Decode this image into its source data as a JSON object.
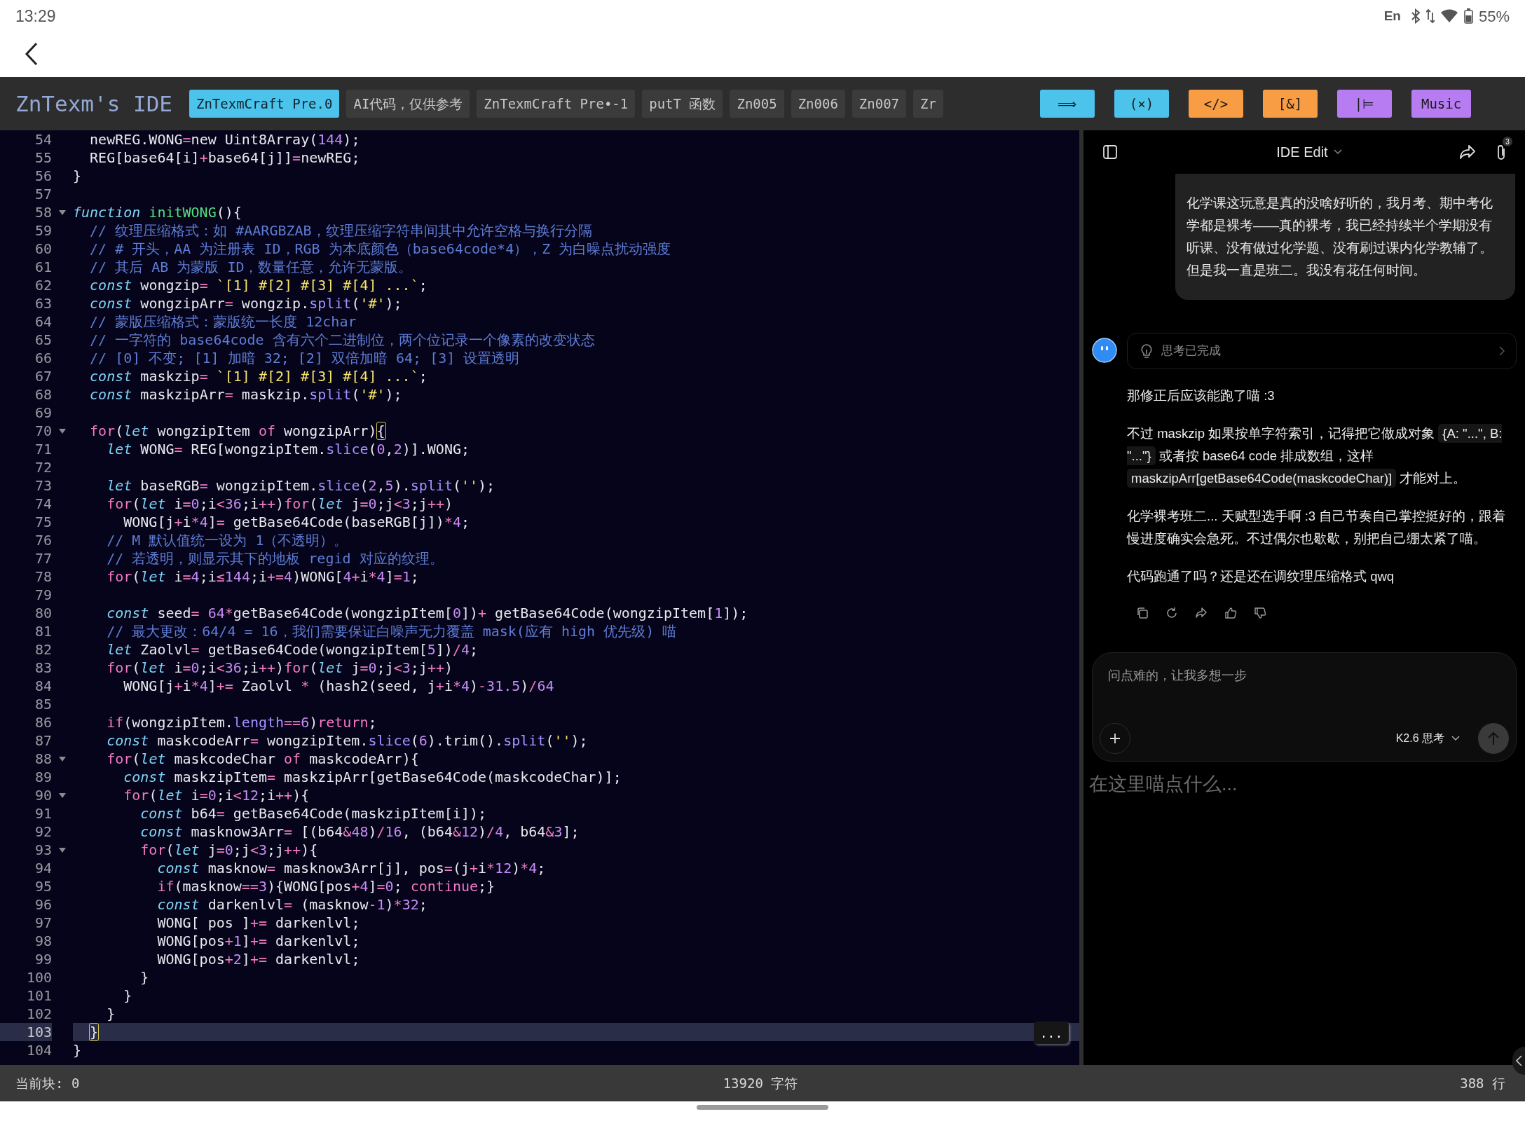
{
  "phone_status": {
    "time": "13:29",
    "input_language": "En",
    "battery": "55%"
  },
  "ide": {
    "title": "ZnTexm's IDE",
    "tabs": [
      {
        "label": "ZnTexmCraft Pre.0",
        "selected": true
      },
      {
        "label": "AI代码，仅供参考",
        "selected": false
      },
      {
        "label": "ZnTexmCraft Pre•-1",
        "selected": false
      },
      {
        "label": "putT 函数",
        "selected": false
      },
      {
        "label": "Zn005",
        "selected": false
      },
      {
        "label": "Zn006",
        "selected": false
      },
      {
        "label": "Zn007",
        "selected": false
      },
      {
        "label": "Zr",
        "selected": false
      }
    ],
    "tools": [
      {
        "label": "⟹",
        "color": "#4cc3ea"
      },
      {
        "label": "(×)",
        "color": "#4cc3ea"
      },
      {
        "label": "</>",
        "color": "#f99d45"
      },
      {
        "label": "[&]",
        "color": "#f99d45"
      },
      {
        "label": "|⊨",
        "color": "#b77cf2"
      },
      {
        "label": "Music",
        "color": "#b77cf2"
      }
    ]
  },
  "editor": {
    "more_button": "...",
    "lines": [
      {
        "number": "54",
        "fold": false,
        "current": false,
        "tokens": [
          {
            "kind": "plain",
            "text": "  newREG.WONG"
          },
          {
            "kind": "op",
            "text": "="
          },
          {
            "kind": "plain",
            "text": "new Uint8Array("
          },
          {
            "kind": "num",
            "text": "144"
          },
          {
            "kind": "plain",
            "text": ");"
          }
        ]
      },
      {
        "number": "55",
        "fold": false,
        "current": false,
        "tokens": [
          {
            "kind": "plain",
            "text": "  REG[base64[i]"
          },
          {
            "kind": "op",
            "text": "+"
          },
          {
            "kind": "plain",
            "text": "base64[j]]"
          },
          {
            "kind": "op",
            "text": "="
          },
          {
            "kind": "plain",
            "text": "newREG;"
          }
        ]
      },
      {
        "number": "56",
        "fold": false,
        "current": false,
        "tokens": [
          {
            "kind": "plain",
            "text": "}"
          }
        ]
      },
      {
        "number": "57",
        "fold": false,
        "current": false
      },
      {
        "number": "58",
        "fold": true,
        "current": false,
        "tokens": [
          {
            "kind": "kw",
            "text": "function"
          },
          {
            "kind": "fn",
            "text": " initWONG"
          },
          {
            "kind": "plain",
            "text": "(){"
          }
        ]
      },
      {
        "number": "59",
        "fold": false,
        "current": false,
        "tokens": [
          {
            "kind": "com",
            "text": "  // 纹理压缩格式：如 #AARGBZAB，纹理压缩字符串间其中允许空格与换行分隔"
          }
        ]
      },
      {
        "number": "60",
        "fold": false,
        "current": false,
        "tokens": [
          {
            "kind": "com",
            "text": "  // # 开头，AA 为注册表 ID，RGB 为本底颜色（base64code*4），Z 为白噪点扰动强度"
          }
        ]
      },
      {
        "number": "61",
        "fold": false,
        "current": false,
        "tokens": [
          {
            "kind": "com",
            "text": "  // 其后 AB 为蒙版 ID，数量任意，允许无蒙版。"
          }
        ]
      },
      {
        "number": "62",
        "fold": false,
        "current": false,
        "tokens": [
          {
            "kind": "kw",
            "text": "  const"
          },
          {
            "kind": "plain",
            "text": " wongzip"
          },
          {
            "kind": "op",
            "text": "="
          },
          {
            "kind": "str",
            "text": " `[1] #[2] #[3] #[4] ...`"
          },
          {
            "kind": "plain",
            "text": ";"
          }
        ]
      },
      {
        "number": "63",
        "fold": false,
        "current": false,
        "tokens": [
          {
            "kind": "kw",
            "text": "  const"
          },
          {
            "kind": "plain",
            "text": " wongzipArr"
          },
          {
            "kind": "op",
            "text": "="
          },
          {
            "kind": "plain",
            "text": " wongzip."
          },
          {
            "kind": "method",
            "text": "split"
          },
          {
            "kind": "plain",
            "text": "("
          },
          {
            "kind": "str",
            "text": "'#'"
          },
          {
            "kind": "plain",
            "text": ");"
          }
        ]
      },
      {
        "number": "64",
        "fold": false,
        "current": false,
        "tokens": [
          {
            "kind": "com",
            "text": "  // 蒙版压缩格式：蒙版统一长度 12char"
          }
        ]
      },
      {
        "number": "65",
        "fold": false,
        "current": false,
        "tokens": [
          {
            "kind": "com",
            "text": "  // 一字符的 base64code 含有六个二进制位，两个位记录一个像素的改变状态"
          }
        ]
      },
      {
        "number": "66",
        "fold": false,
        "current": false,
        "tokens": [
          {
            "kind": "com",
            "text": "  // [0] 不变; [1] 加暗 32; [2] 双倍加暗 64; [3] 设置透明"
          }
        ]
      },
      {
        "number": "67",
        "fold": false,
        "current": false,
        "tokens": [
          {
            "kind": "kw",
            "text": "  const"
          },
          {
            "kind": "plain",
            "text": " maskzip"
          },
          {
            "kind": "op",
            "text": "="
          },
          {
            "kind": "str",
            "text": " `[1] #[2] #[3] #[4] ...`"
          },
          {
            "kind": "plain",
            "text": ";"
          }
        ]
      },
      {
        "number": "68",
        "fold": false,
        "current": false,
        "tokens": [
          {
            "kind": "kw",
            "text": "  const"
          },
          {
            "kind": "plain",
            "text": " maskzipArr"
          },
          {
            "kind": "op",
            "text": "="
          },
          {
            "kind": "plain",
            "text": " maskzip."
          },
          {
            "kind": "method",
            "text": "split"
          },
          {
            "kind": "plain",
            "text": "("
          },
          {
            "kind": "str",
            "text": "'#'"
          },
          {
            "kind": "plain",
            "text": ");"
          }
        ]
      },
      {
        "number": "69",
        "fold": false,
        "current": false
      },
      {
        "number": "70",
        "fold": true,
        "current": false,
        "tokens": [
          {
            "kind": "ctl",
            "text": "  for"
          },
          {
            "kind": "plain",
            "text": "("
          },
          {
            "kind": "kw",
            "text": "let"
          },
          {
            "kind": "plain",
            "text": " wongzipItem "
          },
          {
            "kind": "ctl",
            "text": "of"
          },
          {
            "kind": "plain",
            "text": " wongzipArr)"
          },
          {
            "kind": "match",
            "text": "{"
          }
        ]
      },
      {
        "number": "71",
        "fold": false,
        "current": false,
        "tokens": [
          {
            "kind": "kw",
            "text": "    let"
          },
          {
            "kind": "plain",
            "text": " WONG"
          },
          {
            "kind": "op",
            "text": "="
          },
          {
            "kind": "plain",
            "text": " REG[wongzipItem."
          },
          {
            "kind": "method",
            "text": "slice"
          },
          {
            "kind": "plain",
            "text": "("
          },
          {
            "kind": "num",
            "text": "0"
          },
          {
            "kind": "plain",
            "text": ","
          },
          {
            "kind": "num",
            "text": "2"
          },
          {
            "kind": "plain",
            "text": ")].WONG;"
          }
        ]
      },
      {
        "number": "72",
        "fold": false,
        "current": false
      },
      {
        "number": "73",
        "fold": false,
        "current": false,
        "tokens": [
          {
            "kind": "kw",
            "text": "    let"
          },
          {
            "kind": "plain",
            "text": " baseRGB"
          },
          {
            "kind": "op",
            "text": "="
          },
          {
            "kind": "plain",
            "text": " wongzipItem."
          },
          {
            "kind": "method",
            "text": "slice"
          },
          {
            "kind": "plain",
            "text": "("
          },
          {
            "kind": "num",
            "text": "2"
          },
          {
            "kind": "plain",
            "text": ","
          },
          {
            "kind": "num",
            "text": "5"
          },
          {
            "kind": "plain",
            "text": ")."
          },
          {
            "kind": "method",
            "text": "split"
          },
          {
            "kind": "plain",
            "text": "("
          },
          {
            "kind": "str",
            "text": "''"
          },
          {
            "kind": "plain",
            "text": ");"
          }
        ]
      },
      {
        "number": "74",
        "fold": false,
        "current": false,
        "tokens": [
          {
            "kind": "ctl",
            "text": "    for"
          },
          {
            "kind": "plain",
            "text": "("
          },
          {
            "kind": "kw",
            "text": "let"
          },
          {
            "kind": "plain",
            "text": " i"
          },
          {
            "kind": "op",
            "text": "="
          },
          {
            "kind": "num",
            "text": "0"
          },
          {
            "kind": "plain",
            "text": ";i"
          },
          {
            "kind": "op",
            "text": "<"
          },
          {
            "kind": "num",
            "text": "36"
          },
          {
            "kind": "plain",
            "text": ";i"
          },
          {
            "kind": "op",
            "text": "++"
          },
          {
            "kind": "plain",
            "text": ")"
          },
          {
            "kind": "ctl",
            "text": "for"
          },
          {
            "kind": "plain",
            "text": "("
          },
          {
            "kind": "kw",
            "text": "let"
          },
          {
            "kind": "plain",
            "text": " j"
          },
          {
            "kind": "op",
            "text": "="
          },
          {
            "kind": "num",
            "text": "0"
          },
          {
            "kind": "plain",
            "text": ";j"
          },
          {
            "kind": "op",
            "text": "<"
          },
          {
            "kind": "num",
            "text": "3"
          },
          {
            "kind": "plain",
            "text": ";j"
          },
          {
            "kind": "op",
            "text": "++"
          },
          {
            "kind": "plain",
            "text": ")"
          }
        ]
      },
      {
        "number": "75",
        "fold": false,
        "current": false,
        "tokens": [
          {
            "kind": "plain",
            "text": "      WONG[j"
          },
          {
            "kind": "op",
            "text": "+"
          },
          {
            "kind": "plain",
            "text": "i"
          },
          {
            "kind": "op",
            "text": "*"
          },
          {
            "kind": "num",
            "text": "4"
          },
          {
            "kind": "plain",
            "text": "]"
          },
          {
            "kind": "op",
            "text": "="
          },
          {
            "kind": "plain",
            "text": " getBase64Code(baseRGB[j])"
          },
          {
            "kind": "op",
            "text": "*"
          },
          {
            "kind": "num",
            "text": "4"
          },
          {
            "kind": "plain",
            "text": ";"
          }
        ]
      },
      {
        "number": "76",
        "fold": false,
        "current": false,
        "tokens": [
          {
            "kind": "com",
            "text": "    // M 默认值统一设为 1（不透明）。"
          }
        ]
      },
      {
        "number": "77",
        "fold": false,
        "current": false,
        "tokens": [
          {
            "kind": "com",
            "text": "    // 若透明，则显示其下的地板 regid 对应的纹理。"
          }
        ]
      },
      {
        "number": "78",
        "fold": false,
        "current": false,
        "tokens": [
          {
            "kind": "ctl",
            "text": "    for"
          },
          {
            "kind": "plain",
            "text": "("
          },
          {
            "kind": "kw",
            "text": "let"
          },
          {
            "kind": "plain",
            "text": " i"
          },
          {
            "kind": "op",
            "text": "="
          },
          {
            "kind": "num",
            "text": "4"
          },
          {
            "kind": "plain",
            "text": ";i"
          },
          {
            "kind": "op",
            "text": "≤"
          },
          {
            "kind": "num",
            "text": "144"
          },
          {
            "kind": "plain",
            "text": ";i"
          },
          {
            "kind": "op",
            "text": "+="
          },
          {
            "kind": "num",
            "text": "4"
          },
          {
            "kind": "plain",
            "text": ")WONG["
          },
          {
            "kind": "num",
            "text": "4"
          },
          {
            "kind": "op",
            "text": "+"
          },
          {
            "kind": "plain",
            "text": "i"
          },
          {
            "kind": "op",
            "text": "*"
          },
          {
            "kind": "num",
            "text": "4"
          },
          {
            "kind": "plain",
            "text": "]"
          },
          {
            "kind": "op",
            "text": "="
          },
          {
            "kind": "num",
            "text": "1"
          },
          {
            "kind": "plain",
            "text": ";"
          }
        ]
      },
      {
        "number": "79",
        "fold": false,
        "current": false
      },
      {
        "number": "80",
        "fold": false,
        "current": false,
        "tokens": [
          {
            "kind": "kw",
            "text": "    const"
          },
          {
            "kind": "plain",
            "text": " seed"
          },
          {
            "kind": "op",
            "text": "="
          },
          {
            "kind": "num",
            "text": " 64"
          },
          {
            "kind": "op",
            "text": "*"
          },
          {
            "kind": "plain",
            "text": "getBase64Code(wongzipItem["
          },
          {
            "kind": "num",
            "text": "0"
          },
          {
            "kind": "plain",
            "text": "])"
          },
          {
            "kind": "op",
            "text": "+"
          },
          {
            "kind": "plain",
            "text": " getBase64Code(wongzipItem["
          },
          {
            "kind": "num",
            "text": "1"
          },
          {
            "kind": "plain",
            "text": "]);"
          }
        ]
      },
      {
        "number": "81",
        "fold": false,
        "current": false,
        "tokens": [
          {
            "kind": "com",
            "text": "    // 最大更改：64/4 = 16，我们需要保证白噪声无力覆盖 mask(应有 high 优先级) 喵"
          }
        ]
      },
      {
        "number": "82",
        "fold": false,
        "current": false,
        "tokens": [
          {
            "kind": "kw",
            "text": "    let"
          },
          {
            "kind": "plain",
            "text": " Zaolvl"
          },
          {
            "kind": "op",
            "text": "="
          },
          {
            "kind": "plain",
            "text": " getBase64Code(wongzipItem["
          },
          {
            "kind": "num",
            "text": "5"
          },
          {
            "kind": "plain",
            "text": "])"
          },
          {
            "kind": "op",
            "text": "/"
          },
          {
            "kind": "num",
            "text": "4"
          },
          {
            "kind": "plain",
            "text": ";"
          }
        ]
      },
      {
        "number": "83",
        "fold": false,
        "current": false,
        "tokens": [
          {
            "kind": "ctl",
            "text": "    for"
          },
          {
            "kind": "plain",
            "text": "("
          },
          {
            "kind": "kw",
            "text": "let"
          },
          {
            "kind": "plain",
            "text": " i"
          },
          {
            "kind": "op",
            "text": "="
          },
          {
            "kind": "num",
            "text": "0"
          },
          {
            "kind": "plain",
            "text": ";i"
          },
          {
            "kind": "op",
            "text": "<"
          },
          {
            "kind": "num",
            "text": "36"
          },
          {
            "kind": "plain",
            "text": ";i"
          },
          {
            "kind": "op",
            "text": "++"
          },
          {
            "kind": "plain",
            "text": ")"
          },
          {
            "kind": "ctl",
            "text": "for"
          },
          {
            "kind": "plain",
            "text": "("
          },
          {
            "kind": "kw",
            "text": "let"
          },
          {
            "kind": "plain",
            "text": " j"
          },
          {
            "kind": "op",
            "text": "="
          },
          {
            "kind": "num",
            "text": "0"
          },
          {
            "kind": "plain",
            "text": ";j"
          },
          {
            "kind": "op",
            "text": "<"
          },
          {
            "kind": "num",
            "text": "3"
          },
          {
            "kind": "plain",
            "text": ";j"
          },
          {
            "kind": "op",
            "text": "++"
          },
          {
            "kind": "plain",
            "text": ")"
          }
        ]
      },
      {
        "number": "84",
        "fold": false,
        "current": false,
        "tokens": [
          {
            "kind": "plain",
            "text": "      WONG[j"
          },
          {
            "kind": "op",
            "text": "+"
          },
          {
            "kind": "plain",
            "text": "i"
          },
          {
            "kind": "op",
            "text": "*"
          },
          {
            "kind": "num",
            "text": "4"
          },
          {
            "kind": "plain",
            "text": "]"
          },
          {
            "kind": "op",
            "text": "+="
          },
          {
            "kind": "plain",
            "text": " Zaolvl "
          },
          {
            "kind": "op",
            "text": "*"
          },
          {
            "kind": "plain",
            "text": " (hash2(seed, j"
          },
          {
            "kind": "op",
            "text": "+"
          },
          {
            "kind": "plain",
            "text": "i"
          },
          {
            "kind": "op",
            "text": "*"
          },
          {
            "kind": "num",
            "text": "4"
          },
          {
            "kind": "plain",
            "text": ")"
          },
          {
            "kind": "op",
            "text": "-"
          },
          {
            "kind": "num",
            "text": "31.5"
          },
          {
            "kind": "plain",
            "text": ")"
          },
          {
            "kind": "op",
            "text": "/"
          },
          {
            "kind": "num",
            "text": "64"
          }
        ]
      },
      {
        "number": "85",
        "fold": false,
        "current": false
      },
      {
        "number": "86",
        "fold": false,
        "current": false,
        "tokens": [
          {
            "kind": "ctl",
            "text": "    if"
          },
          {
            "kind": "plain",
            "text": "(wongzipItem."
          },
          {
            "kind": "method",
            "text": "length"
          },
          {
            "kind": "op",
            "text": "=="
          },
          {
            "kind": "num",
            "text": "6"
          },
          {
            "kind": "plain",
            "text": ")"
          },
          {
            "kind": "ctl",
            "text": "return"
          },
          {
            "kind": "plain",
            "text": ";"
          }
        ]
      },
      {
        "number": "87",
        "fold": false,
        "current": false,
        "tokens": [
          {
            "kind": "kw",
            "text": "    const"
          },
          {
            "kind": "plain",
            "text": " maskcodeArr"
          },
          {
            "kind": "op",
            "text": "="
          },
          {
            "kind": "plain",
            "text": " wongzipItem."
          },
          {
            "kind": "method",
            "text": "slice"
          },
          {
            "kind": "plain",
            "text": "("
          },
          {
            "kind": "num",
            "text": "6"
          },
          {
            "kind": "plain",
            "text": ").trim()."
          },
          {
            "kind": "method",
            "text": "split"
          },
          {
            "kind": "plain",
            "text": "("
          },
          {
            "kind": "str",
            "text": "''"
          },
          {
            "kind": "plain",
            "text": ");"
          }
        ]
      },
      {
        "number": "88",
        "fold": true,
        "current": false,
        "tokens": [
          {
            "kind": "ctl",
            "text": "    for"
          },
          {
            "kind": "plain",
            "text": "("
          },
          {
            "kind": "kw",
            "text": "let"
          },
          {
            "kind": "plain",
            "text": " maskcodeChar "
          },
          {
            "kind": "ctl",
            "text": "of"
          },
          {
            "kind": "plain",
            "text": " maskcodeArr){"
          }
        ]
      },
      {
        "number": "89",
        "fold": false,
        "current": false,
        "tokens": [
          {
            "kind": "kw",
            "text": "      const"
          },
          {
            "kind": "plain",
            "text": " maskzipItem"
          },
          {
            "kind": "op",
            "text": "="
          },
          {
            "kind": "plain",
            "text": " maskzipArr[getBase64Code(maskcodeChar)];"
          }
        ]
      },
      {
        "number": "90",
        "fold": true,
        "current": false,
        "tokens": [
          {
            "kind": "ctl",
            "text": "      for"
          },
          {
            "kind": "plain",
            "text": "("
          },
          {
            "kind": "kw",
            "text": "let"
          },
          {
            "kind": "plain",
            "text": " i"
          },
          {
            "kind": "op",
            "text": "="
          },
          {
            "kind": "num",
            "text": "0"
          },
          {
            "kind": "plain",
            "text": ";i"
          },
          {
            "kind": "op",
            "text": "<"
          },
          {
            "kind": "num",
            "text": "12"
          },
          {
            "kind": "plain",
            "text": ";i"
          },
          {
            "kind": "op",
            "text": "++"
          },
          {
            "kind": "plain",
            "text": "){"
          }
        ]
      },
      {
        "number": "91",
        "fold": false,
        "current": false,
        "tokens": [
          {
            "kind": "kw",
            "text": "        const"
          },
          {
            "kind": "plain",
            "text": " b64"
          },
          {
            "kind": "op",
            "text": "="
          },
          {
            "kind": "plain",
            "text": " getBase64Code(maskzipItem[i]);"
          }
        ]
      },
      {
        "number": "92",
        "fold": false,
        "current": false,
        "tokens": [
          {
            "kind": "kw",
            "text": "        const"
          },
          {
            "kind": "plain",
            "text": " masknow3Arr"
          },
          {
            "kind": "op",
            "text": "="
          },
          {
            "kind": "plain",
            "text": " [(b64"
          },
          {
            "kind": "op",
            "text": "&"
          },
          {
            "kind": "num",
            "text": "48"
          },
          {
            "kind": "plain",
            "text": ")"
          },
          {
            "kind": "op",
            "text": "/"
          },
          {
            "kind": "num",
            "text": "16"
          },
          {
            "kind": "plain",
            "text": ", (b64"
          },
          {
            "kind": "op",
            "text": "&"
          },
          {
            "kind": "num",
            "text": "12"
          },
          {
            "kind": "plain",
            "text": ")"
          },
          {
            "kind": "op",
            "text": "/"
          },
          {
            "kind": "num",
            "text": "4"
          },
          {
            "kind": "plain",
            "text": ", b64"
          },
          {
            "kind": "op",
            "text": "&"
          },
          {
            "kind": "num",
            "text": "3"
          },
          {
            "kind": "plain",
            "text": "];"
          }
        ]
      },
      {
        "number": "93",
        "fold": true,
        "current": false,
        "tokens": [
          {
            "kind": "ctl",
            "text": "        for"
          },
          {
            "kind": "plain",
            "text": "("
          },
          {
            "kind": "kw",
            "text": "let"
          },
          {
            "kind": "plain",
            "text": " j"
          },
          {
            "kind": "op",
            "text": "="
          },
          {
            "kind": "num",
            "text": "0"
          },
          {
            "kind": "plain",
            "text": ";j"
          },
          {
            "kind": "op",
            "text": "<"
          },
          {
            "kind": "num",
            "text": "3"
          },
          {
            "kind": "plain",
            "text": ";j"
          },
          {
            "kind": "op",
            "text": "++"
          },
          {
            "kind": "plain",
            "text": "){"
          }
        ]
      },
      {
        "number": "94",
        "fold": false,
        "current": false,
        "tokens": [
          {
            "kind": "kw",
            "text": "          const"
          },
          {
            "kind": "plain",
            "text": " masknow"
          },
          {
            "kind": "op",
            "text": "="
          },
          {
            "kind": "plain",
            "text": " masknow3Arr[j], pos"
          },
          {
            "kind": "op",
            "text": "="
          },
          {
            "kind": "plain",
            "text": "(j"
          },
          {
            "kind": "op",
            "text": "+"
          },
          {
            "kind": "plain",
            "text": "i"
          },
          {
            "kind": "op",
            "text": "*"
          },
          {
            "kind": "num",
            "text": "12"
          },
          {
            "kind": "plain",
            "text": ")"
          },
          {
            "kind": "op",
            "text": "*"
          },
          {
            "kind": "num",
            "text": "4"
          },
          {
            "kind": "plain",
            "text": ";"
          }
        ]
      },
      {
        "number": "95",
        "fold": false,
        "current": false,
        "tokens": [
          {
            "kind": "ctl",
            "text": "          if"
          },
          {
            "kind": "plain",
            "text": "(masknow"
          },
          {
            "kind": "op",
            "text": "=="
          },
          {
            "kind": "num",
            "text": "3"
          },
          {
            "kind": "plain",
            "text": "){WONG[pos"
          },
          {
            "kind": "op",
            "text": "+"
          },
          {
            "kind": "num",
            "text": "4"
          },
          {
            "kind": "plain",
            "text": "]"
          },
          {
            "kind": "op",
            "text": "="
          },
          {
            "kind": "num",
            "text": "0"
          },
          {
            "kind": "plain",
            "text": ";"
          },
          {
            "kind": "ctl",
            "text": " continue"
          },
          {
            "kind": "plain",
            "text": ";}"
          }
        ]
      },
      {
        "number": "96",
        "fold": false,
        "current": false,
        "tokens": [
          {
            "kind": "kw",
            "text": "          const"
          },
          {
            "kind": "plain",
            "text": " darkenlvl"
          },
          {
            "kind": "op",
            "text": "="
          },
          {
            "kind": "plain",
            "text": " (masknow"
          },
          {
            "kind": "op",
            "text": "-"
          },
          {
            "kind": "num",
            "text": "1"
          },
          {
            "kind": "plain",
            "text": ")"
          },
          {
            "kind": "op",
            "text": "*"
          },
          {
            "kind": "num",
            "text": "32"
          },
          {
            "kind": "plain",
            "text": ";"
          }
        ]
      },
      {
        "number": "97",
        "fold": false,
        "current": false,
        "tokens": [
          {
            "kind": "plain",
            "text": "          WONG[ pos ]"
          },
          {
            "kind": "op",
            "text": "+="
          },
          {
            "kind": "plain",
            "text": " darkenlvl;"
          }
        ]
      },
      {
        "number": "98",
        "fold": false,
        "current": false,
        "tokens": [
          {
            "kind": "plain",
            "text": "          WONG[pos"
          },
          {
            "kind": "op",
            "text": "+"
          },
          {
            "kind": "num",
            "text": "1"
          },
          {
            "kind": "plain",
            "text": "]"
          },
          {
            "kind": "op",
            "text": "+="
          },
          {
            "kind": "plain",
            "text": " darkenlvl;"
          }
        ]
      },
      {
        "number": "99",
        "fold": false,
        "current": false,
        "tokens": [
          {
            "kind": "plain",
            "text": "          WONG[pos"
          },
          {
            "kind": "op",
            "text": "+"
          },
          {
            "kind": "num",
            "text": "2"
          },
          {
            "kind": "plain",
            "text": "]"
          },
          {
            "kind": "op",
            "text": "+="
          },
          {
            "kind": "plain",
            "text": " darkenlvl;"
          }
        ]
      },
      {
        "number": "100",
        "fold": false,
        "current": false,
        "tokens": [
          {
            "kind": "plain",
            "text": "        }"
          }
        ]
      },
      {
        "number": "101",
        "fold": false,
        "current": false,
        "tokens": [
          {
            "kind": "plain",
            "text": "      }"
          }
        ]
      },
      {
        "number": "102",
        "fold": false,
        "current": false,
        "tokens": [
          {
            "kind": "plain",
            "text": "    }"
          }
        ]
      },
      {
        "number": "103",
        "fold": false,
        "current": true,
        "tokens": [
          {
            "kind": "match",
            "text": "  }"
          }
        ]
      },
      {
        "number": "104",
        "fold": false,
        "current": false,
        "tokens": [
          {
            "kind": "plain",
            "text": "}"
          }
        ]
      }
    ]
  },
  "chat": {
    "header_title": "IDE Edit",
    "attachment_count": "3",
    "messages": [
      {
        "kind": "user",
        "text": "化学课这玩意是真的没啥好听的，我月考、期中考化学都是裸考——真的裸考，我已经持续半个学期没有听课、没有做过化学题、没有刷过课内化学教辅了。但是我一直是班二。我没有花任何时间。"
      },
      {
        "kind": "assistant",
        "thinking": "思考已完成",
        "paragraphs": [
          [
            {
              "kind": "text",
              "text": "那修正后应该能跑了喵 :3"
            }
          ],
          [
            {
              "kind": "text",
              "text": "不过 maskzip 如果按单字符索引，记得把它做成对象 "
            },
            {
              "kind": "code",
              "text": "{A: \"...\", B: \"...\"}"
            },
            {
              "kind": "text",
              "text": " 或者按 base64 code 排成数组，这样 "
            },
            {
              "kind": "code",
              "text": "maskzipArr[getBase64Code(maskcodeChar)]"
            },
            {
              "kind": "text",
              "text": " 才能对上。"
            }
          ],
          [
            {
              "kind": "text",
              "text": "化学裸考班二... 天赋型选手啊 :3 自己节奏自己掌控挺好的，跟着慢进度确实会急死。不过偶尔也歇歇，别把自己绷太紧了喵。"
            }
          ],
          [
            {
              "kind": "text",
              "text": "代码跑通了吗？还是还在调纹理压缩格式 qwq"
            }
          ]
        ]
      }
    ],
    "composer": {
      "placeholder": "问点难的，让我多想一步",
      "model": "K2.6 思考"
    },
    "ide_input": {
      "placeholder": "在这里喵点什么..."
    }
  },
  "footer": {
    "current_block": "当前块: 0",
    "chars": "13920 字符",
    "lines": "388 行"
  }
}
